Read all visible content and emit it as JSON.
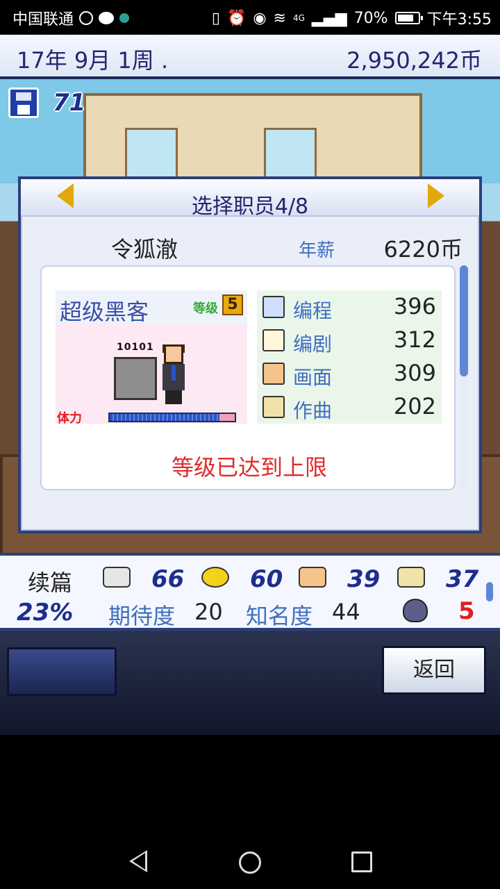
{
  "status_bar": {
    "carrier": "中国联通",
    "network": "4G",
    "battery_pct": "70%",
    "time": "下午3:55"
  },
  "top_bar": {
    "date": "17年 9月 1周 .",
    "money": "2,950,242币"
  },
  "save": {
    "count": "71"
  },
  "dialog": {
    "title": "选择职员4/8",
    "employee_name": "令狐澈",
    "salary_label": "年薪",
    "salary_value": "6220币",
    "card": {
      "job_title": "超级黑客",
      "level_label": "等级",
      "level": "5",
      "pc_text": "10101",
      "stamina_label": "体力",
      "stamina_fraction": 0.88
    },
    "stats": [
      {
        "icon": "computer-icon",
        "label": "编程",
        "value": "396"
      },
      {
        "icon": "book-pen-icon",
        "label": "编剧",
        "value": "312"
      },
      {
        "icon": "palette-icon",
        "label": "画面",
        "value": "309"
      },
      {
        "icon": "trumpet-icon",
        "label": "作曲",
        "value": "202"
      }
    ],
    "max_level_message": "等级已达到上限"
  },
  "info_strip": {
    "sequel_label": "续篇",
    "sequel_pct": "23%",
    "genre_scores": [
      {
        "icon": "gamepad-icon",
        "value": "66"
      },
      {
        "icon": "coin-icon",
        "value": "60"
      },
      {
        "icon": "palette-icon",
        "value": "39"
      },
      {
        "icon": "trumpet-icon",
        "value": "37"
      }
    ],
    "expectation_label": "期待度",
    "expectation_value": "20",
    "fame_label": "知名度",
    "fame_value": "44",
    "mascot_value": "5"
  },
  "bottom_bar": {
    "back_label": "返回"
  },
  "colors": {
    "accent_blue": "#24246e",
    "stat_label_blue": "#3f6fbf",
    "warning_red": "#e02a2a",
    "arrow_gold": "#e3a70c"
  }
}
